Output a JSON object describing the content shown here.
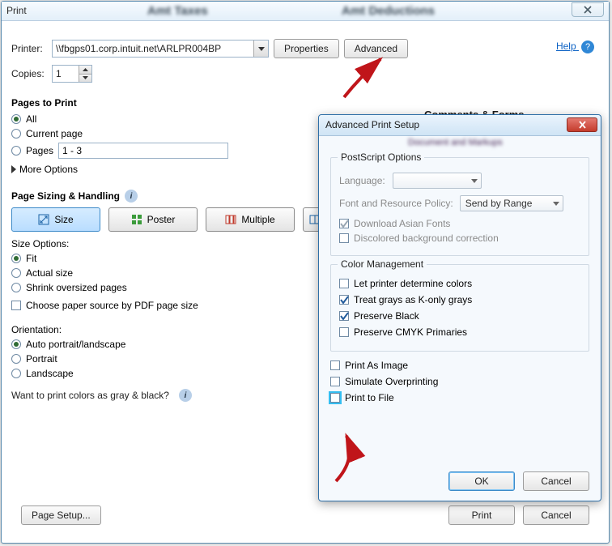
{
  "window": {
    "title": "Print",
    "blur_a": "Amt Taxes",
    "blur_b": "Amt Deductions",
    "help_label": "Help"
  },
  "top": {
    "printer_label": "Printer:",
    "printer_value": "\\\\fbgps01.corp.intuit.net\\ARLPR004BP",
    "properties_btn": "Properties",
    "advanced_btn": "Advanced",
    "copies_label": "Copies:",
    "copies_value": "1"
  },
  "pages": {
    "head": "Pages to Print",
    "all": "All",
    "current": "Current page",
    "pages_label": "Pages",
    "pages_value": "1 - 3",
    "more": "More Options"
  },
  "handling": {
    "head": "Page Sizing & Handling",
    "size": "Size",
    "poster": "Poster",
    "multiple": "Multiple",
    "size_options_head": "Size Options:",
    "fit": "Fit",
    "actual": "Actual size",
    "shrink": "Shrink oversized pages",
    "choose_paper": "Choose paper source by PDF page size"
  },
  "orient": {
    "head": "Orientation:",
    "auto": "Auto portrait/landscape",
    "portrait": "Portrait",
    "landscape": "Landscape",
    "gray_q": "Want to print colors as gray & black?"
  },
  "comments_head": "Comments & Forms",
  "bottom": {
    "page_setup": "Page Setup...",
    "print": "Print",
    "cancel": "Cancel"
  },
  "adv": {
    "title": "Advanced Print Setup",
    "sub_blur": "Document and Markups",
    "ps": {
      "head": "PostScript Options",
      "language_label": "Language:",
      "policy_label": "Font and Resource Policy:",
      "policy_value": "Send by Range",
      "download_asian": "Download Asian Fonts",
      "discolored": "Discolored background correction"
    },
    "cm": {
      "head": "Color Management",
      "let_printer": "Let printer determine colors",
      "treat_grays": "Treat grays as K-only grays",
      "preserve_black": "Preserve Black",
      "preserve_cmyk": "Preserve CMYK Primaries"
    },
    "misc": {
      "print_as_image": "Print As Image",
      "simulate": "Simulate Overprinting",
      "print_to_file": "Print to File"
    },
    "ok": "OK",
    "cancel": "Cancel"
  }
}
